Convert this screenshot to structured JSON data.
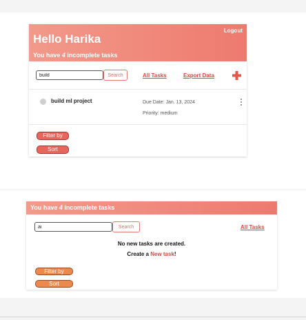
{
  "colors": {
    "header_gradient_start": "#f29a8b",
    "header_gradient_end": "#ee7a6e",
    "accent_red": "#d9473f",
    "filter_red": "#e8675c",
    "filter_orange": "#ec8a4e"
  },
  "panel1": {
    "logout_label": "Logout",
    "greeting": "Hello Harika",
    "incomplete_prefix": "You have ",
    "incomplete_count": "4",
    "incomplete_suffix": " incomplete tasks",
    "search_value": "build",
    "search_button": "Search",
    "all_tasks_link": "All Tasks",
    "export_link": "Export Data",
    "add_icon": "plus-icon",
    "tasks": [
      {
        "title": "build ml project",
        "due": "Due Date: Jan. 13, 2024",
        "priority": "Priority: medium"
      }
    ],
    "filter_label": "Filter by",
    "sort_label": "Sort"
  },
  "panel2": {
    "incomplete_prefix": "You have ",
    "incomplete_count": "4",
    "incomplete_suffix": " incomplete tasks",
    "search_value": "ai",
    "search_button": "Search",
    "all_tasks_link": "All Tasks",
    "empty_message": "No new tasks are created.",
    "create_prefix": "Create a ",
    "create_link": "New task",
    "create_suffix": "!",
    "filter_label": "Filter by",
    "sort_label": "Sort"
  }
}
